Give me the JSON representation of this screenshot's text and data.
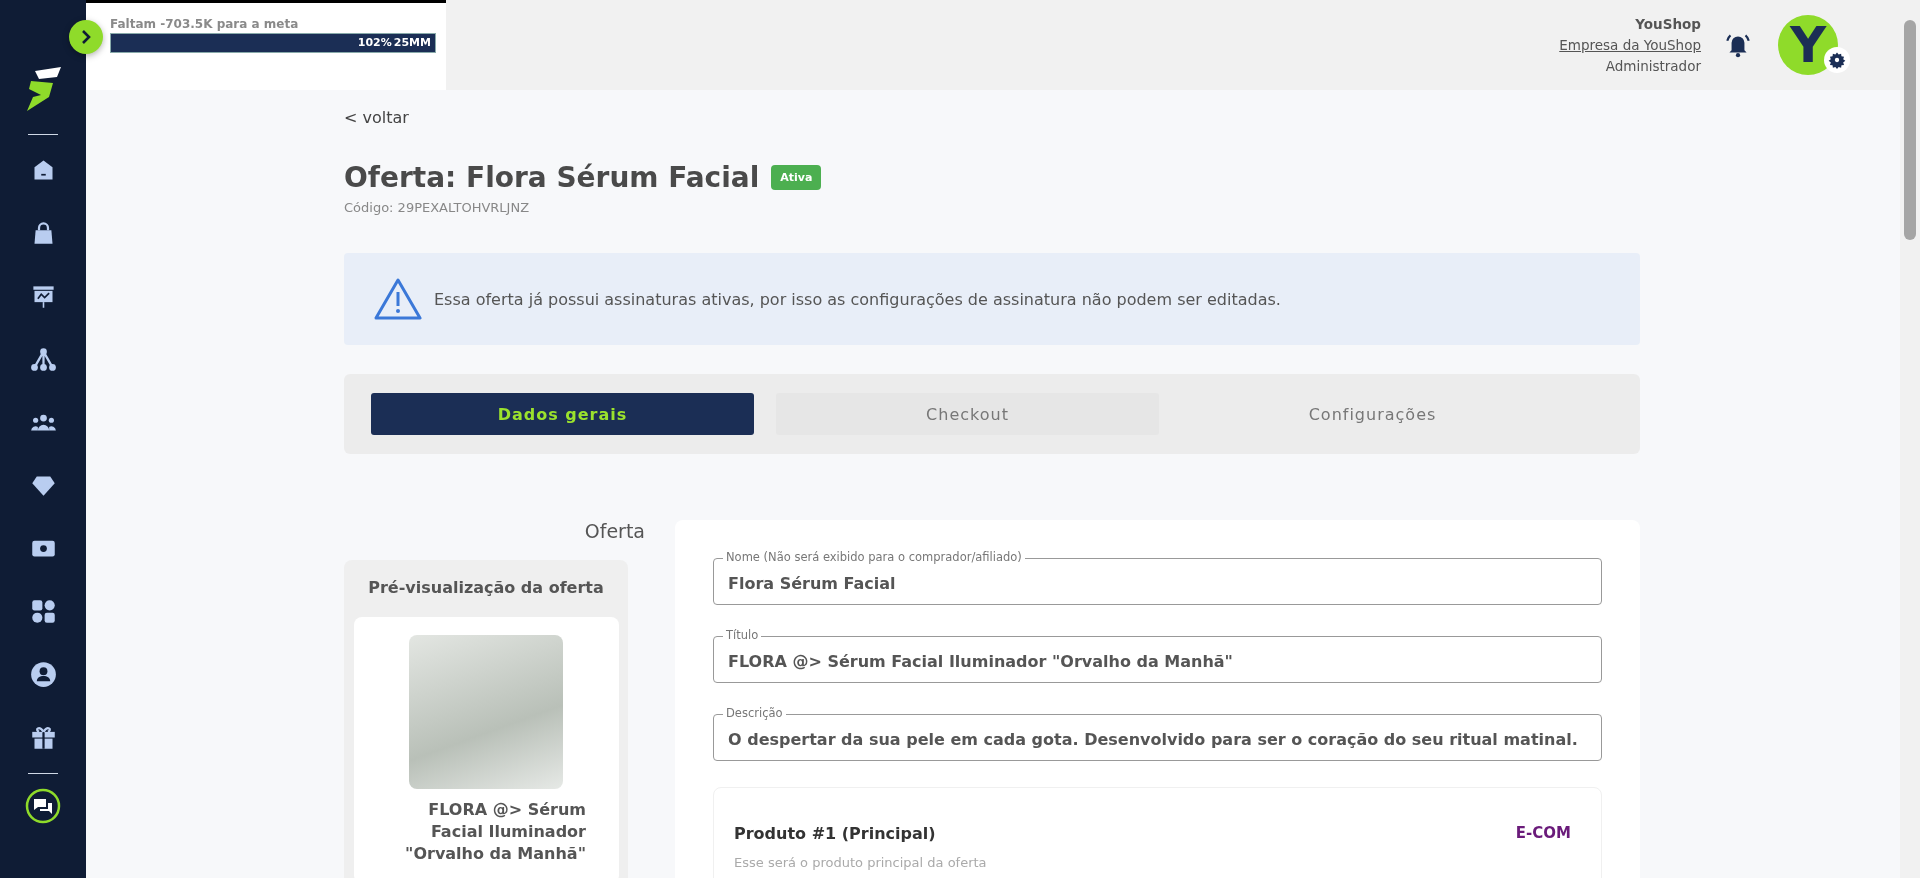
{
  "goal": {
    "text": "Faltam -703.5K para a meta",
    "level": 1,
    "percent": "102%",
    "target": "25MM"
  },
  "sidebar": {
    "items": [
      {
        "kind": "home"
      },
      {
        "kind": "bag"
      },
      {
        "kind": "presentation"
      },
      {
        "kind": "network"
      },
      {
        "kind": "team"
      },
      {
        "kind": "diamond"
      },
      {
        "kind": "money"
      },
      {
        "kind": "apps"
      },
      {
        "kind": "user"
      },
      {
        "kind": "gift"
      }
    ]
  },
  "user": {
    "name": "YouShop",
    "company": "Empresa da YouShop",
    "role": "Administrador",
    "avatar_letter": "Y"
  },
  "back_link": "< voltar",
  "page": {
    "title": "Oferta: Flora Sérum Facial",
    "status": "Ativa",
    "code": "Código: 29PEXALTOHVRLJNZ"
  },
  "alert": "Essa oferta já possui assinaturas ativas, por isso as configurações de assinatura não podem ser editadas.",
  "tabs": [
    {
      "label": "Dados gerais",
      "selected": true
    },
    {
      "label": "Checkout",
      "selected": false
    },
    {
      "label": "Configurações",
      "selected": false
    }
  ],
  "section_title": "Oferta",
  "preview": {
    "title": "Pré-visualização da oferta",
    "product_name": "FLORA @> Sérum Facial Iluminador \"Orvalho da Manhã\""
  },
  "fields": [
    {
      "label": "Nome (Não será exibido para o comprador/afiliado)",
      "value": "Flora Sérum Facial"
    },
    {
      "label": "Título",
      "value": "FLORA @> Sérum Facial Iluminador \"Orvalho da Manhã\""
    },
    {
      "label": "Descrição",
      "value": "O despertar da sua pele em cada gota. Desenvolvido para ser o coração do seu ritual matinal."
    }
  ],
  "product": {
    "title": "Produto #1 (Principal)",
    "subtitle": "Esse será o produto principal da oferta",
    "logo_text": "E-COM"
  }
}
